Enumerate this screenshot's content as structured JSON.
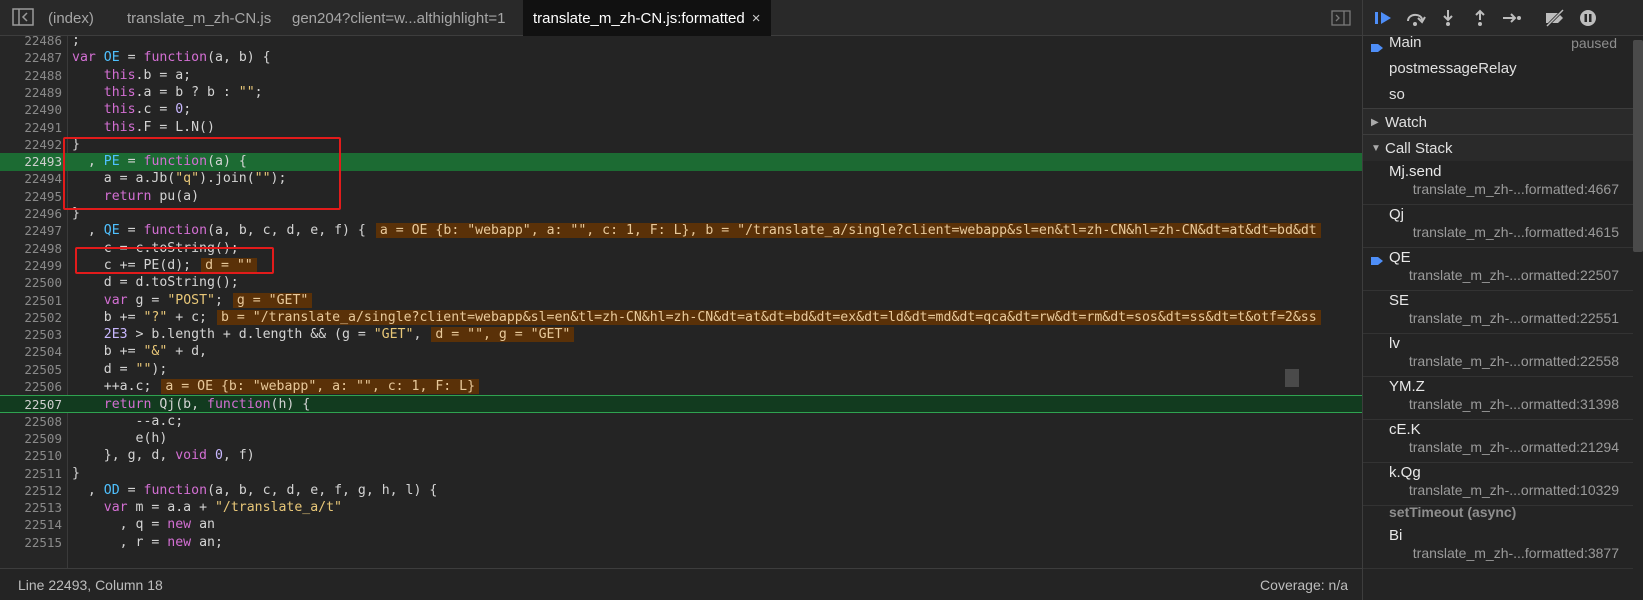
{
  "tabs": [
    {
      "label": "(index)"
    },
    {
      "label": "translate_m_zh-CN.js"
    },
    {
      "label": "gen204?client=w...althighlight=1"
    },
    {
      "label": "translate_m_zh-CN.js:formatted",
      "active": true
    }
  ],
  "tab_close_glyph": "×",
  "code_lines": [
    {
      "num": "22486",
      "html": "<span class='pl'>;</span>"
    },
    {
      "num": "22487",
      "html": "<span class='kw'>var</span> <span class='fn'>OE</span> <span class='pl'>=</span> <span class='kw'>function</span><span class='pl'>(a, b) {</span>"
    },
    {
      "num": "22488",
      "html": "    <span class='kw'>this</span><span class='pl'>.b = a;</span>"
    },
    {
      "num": "22489",
      "html": "    <span class='kw'>this</span><span class='pl'>.a = b ? b : </span><span class='str'>\"\"</span><span class='pl'>;</span>"
    },
    {
      "num": "22490",
      "html": "    <span class='kw'>this</span><span class='pl'>.c = </span><span class='num'>0</span><span class='pl'>;</span>"
    },
    {
      "num": "22491",
      "html": "    <span class='kw'>this</span><span class='pl'>.F = L.N()</span>"
    },
    {
      "num": "22492",
      "html": "<span class='pl'>}</span>"
    },
    {
      "num": "22493",
      "html": "  <span class='pl'>, </span><span class='fn'>PE</span> <span class='pl'>=</span> <span class='kw'>function</span><span class='pl'>(a) {</span>",
      "state": "paused"
    },
    {
      "num": "22494",
      "html": "    <span class='pl'>a = a.Jb(</span><span class='str'>\"q\"</span><span class='pl'>).join(</span><span class='str'>\"\"</span><span class='pl'>);</span>"
    },
    {
      "num": "22495",
      "html": "    <span class='kw'>return</span> <span class='pl'>pu(a)</span>"
    },
    {
      "num": "22496",
      "html": "<span class='pl'>}</span>"
    },
    {
      "num": "22497",
      "html": "  <span class='pl'>, </span><span class='fn'>QE</span> <span class='pl'>=</span> <span class='kw'>function</span><span class='pl'>(a, b, c, d, e, f) {</span><span class='inline-val'>a = OE {b: \"webapp\", a: \"\", c: 1, F: L}, b = \"/translate_a/single?client=webapp&amp;sl=en&amp;tl=zh-CN&amp;hl=zh-CN&amp;dt=at&amp;dt=bd&amp;dt</span>"
    },
    {
      "num": "22498",
      "html": "    <span class='pl'>c = c.toString();</span>"
    },
    {
      "num": "22499",
      "html": "    <span class='pl'>c += PE(d);</span><span class='inline-val'>d = \"\"</span>"
    },
    {
      "num": "22500",
      "html": "    <span class='pl'>d = d.toString();</span>"
    },
    {
      "num": "22501",
      "html": "    <span class='kw'>var</span> <span class='pl'>g = </span><span class='str'>\"POST\"</span><span class='pl'>;</span><span class='inline-val'>g = \"GET\"</span>"
    },
    {
      "num": "22502",
      "html": "    <span class='pl'>b += </span><span class='str'>\"?\"</span><span class='pl'> + c;</span><span class='inline-val'>b = \"/translate_a/single?client=webapp&amp;sl=en&amp;tl=zh-CN&amp;hl=zh-CN&amp;dt=at&amp;dt=bd&amp;dt=ex&amp;dt=ld&amp;dt=md&amp;dt=qca&amp;dt=rw&amp;dt=rm&amp;dt=sos&amp;dt=ss&amp;dt=t&amp;otf=2&amp;ss</span>"
    },
    {
      "num": "22503",
      "html": "    <span class='num'>2E3</span><span class='pl'> &gt; b.length + d.length &amp;&amp; (g = </span><span class='str'>\"GET\"</span><span class='pl'>,</span><span class='inline-val'>d = \"\", g = \"GET\"</span>"
    },
    {
      "num": "22504",
      "html": "    <span class='pl'>b += </span><span class='str'>\"&amp;\"</span><span class='pl'> + d,</span>"
    },
    {
      "num": "22505",
      "html": "    <span class='pl'>d = </span><span class='str'>\"\"</span><span class='pl'>);</span>"
    },
    {
      "num": "22506",
      "html": "    <span class='pl'>++a.c;</span><span class='inline-val'>a = OE {b: \"webapp\", a: \"\", c: 1, F: L}</span>"
    },
    {
      "num": "22507",
      "html": "    <span class='kw'>return</span> <span class='pl'>Qj(b, </span><span class='kw'>function</span><span class='pl'>(h) {</span>",
      "state": "exec"
    },
    {
      "num": "22508",
      "html": "        <span class='pl'>--a.c;</span>"
    },
    {
      "num": "22509",
      "html": "        <span class='pl'>e(h)</span>"
    },
    {
      "num": "22510",
      "html": "    <span class='pl'>}, g, d, </span><span class='kw'>void</span> <span class='num'>0</span><span class='pl'>, f)</span>"
    },
    {
      "num": "22511",
      "html": "<span class='pl'>}</span>"
    },
    {
      "num": "22512",
      "html": "  <span class='pl'>, </span><span class='fn'>OD</span> <span class='pl'>=</span> <span class='kw'>function</span><span class='pl'>(a, b, c, d, e, f, g, h, l) {</span>"
    },
    {
      "num": "22513",
      "html": "    <span class='kw'>var</span> <span class='pl'>m = a.a + </span><span class='str'>\"/translate_a/t\"</span>"
    },
    {
      "num": "22514",
      "html": "      <span class='pl'>, q = </span><span class='kw'>new</span> <span class='pl'>an</span>"
    },
    {
      "num": "22515",
      "html": "      <span class='pl'>, r = </span><span class='kw'>new</span> <span class='pl'>an;</span>"
    }
  ],
  "status": {
    "position": "Line 22493, Column 18",
    "coverage": "Coverage: n/a"
  },
  "threads": [
    {
      "name": "Main",
      "status": "paused",
      "current": true
    },
    {
      "name": "postmessageRelay",
      "status": ""
    },
    {
      "name": "so",
      "status": ""
    }
  ],
  "sections": {
    "watch": "Watch",
    "call_stack": "Call Stack"
  },
  "call_stack": [
    {
      "name": "Mj.send",
      "loc": "translate_m_zh-...formatted:4667"
    },
    {
      "name": "Qj",
      "loc": "translate_m_zh-...formatted:4615"
    },
    {
      "name": "QE",
      "loc": "translate_m_zh-...ormatted:22507",
      "current": true
    },
    {
      "name": "SE",
      "loc": "translate_m_zh-...ormatted:22551"
    },
    {
      "name": "lv",
      "loc": "translate_m_zh-...ormatted:22558"
    },
    {
      "name": "YM.Z",
      "loc": "translate_m_zh-...ormatted:31398"
    },
    {
      "name": "cE.K",
      "loc": "translate_m_zh-...ormatted:21294"
    },
    {
      "name": "k.Qg",
      "loc": "translate_m_zh-...ormatted:10329"
    }
  ],
  "async_label": "setTimeout (async)",
  "async_frames": [
    {
      "name": "Bi",
      "loc": "translate_m_zh-...formatted:3877"
    }
  ],
  "colors": {
    "paused_line": "#1c6b33",
    "exec_line": "#123b1f",
    "annotation_box": "#e21b1b",
    "accent_blue": "#4e8ef7"
  },
  "icons": {
    "left": "sidebar-toggle-icon",
    "right": "debugger-sidebar-toggle-icon",
    "debug_buttons": [
      "resume-icon",
      "step-over-icon",
      "step-into-icon",
      "step-out-icon",
      "step-icon",
      "deactivate-breakpoints-icon",
      "pause-on-exceptions-icon"
    ]
  }
}
